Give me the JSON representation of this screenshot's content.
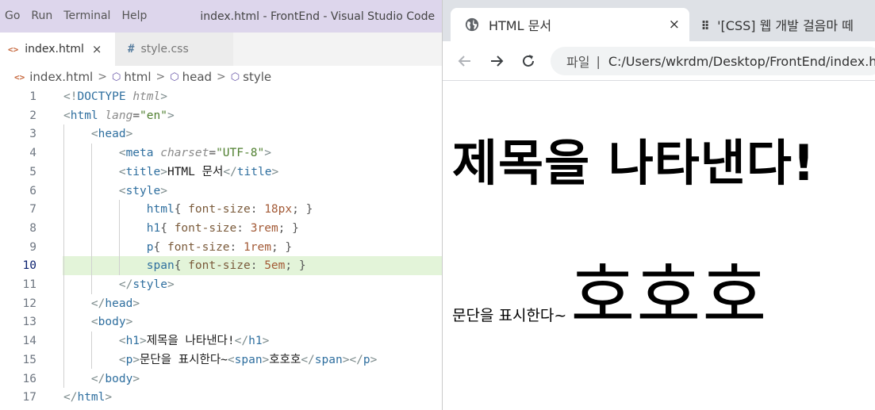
{
  "vscode": {
    "menu": [
      "Go",
      "Run",
      "Terminal",
      "Help"
    ],
    "window_title": "index.html - FrontEnd - Visual Studio Code",
    "tabs": [
      {
        "icon": "<>",
        "label": "index.html",
        "close": "×"
      },
      {
        "icon": "#",
        "label": "style.css"
      }
    ],
    "breadcrumb": {
      "file": "index.html",
      "items": [
        "html",
        "head",
        "style"
      ],
      "sep": ">"
    },
    "line_numbers": [
      "1",
      "2",
      "3",
      "4",
      "5",
      "6",
      "7",
      "8",
      "9",
      "10",
      "11",
      "12",
      "13",
      "14",
      "15",
      "16",
      "17"
    ],
    "current_line": "10",
    "code_lines": [
      "<!DOCTYPE html>",
      "<html lang=\"en\">",
      "    <head>",
      "        <meta charset=\"UTF-8\">",
      "        <title>HTML 문서</title>",
      "        <style>",
      "            html{ font-size: 18px; }",
      "            h1{ font-size: 3rem; }",
      "            p{ font-size: 1rem; }",
      "            span{ font-size: 5em; }",
      "        </style>",
      "    </head>",
      "    <body>",
      "        <h1>제목을 나타낸다!</h1>",
      "        <p>문단을 표시한다~<span>호호호</span></p>",
      "    </body>",
      "</html>"
    ]
  },
  "chrome": {
    "tabs": [
      {
        "label": "HTML 문서",
        "close": "×"
      },
      {
        "label": "'[CSS] 웹 개발 걸음마 떼"
      }
    ],
    "address": {
      "label": "파일",
      "sep": "|",
      "url": "C:/Users/wkrdm/Desktop/FrontEnd/index.html"
    },
    "page": {
      "h1": "제목을 나타낸다!",
      "p_text": "문단을 표시한다~",
      "span_text": "호호호"
    }
  }
}
